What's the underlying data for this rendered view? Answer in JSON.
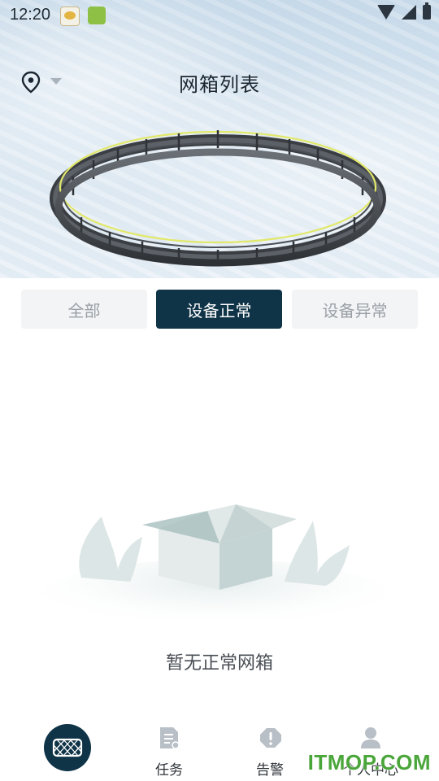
{
  "status_bar": {
    "time": "12:20"
  },
  "header": {
    "title": "网箱列表"
  },
  "tabs": [
    {
      "label": "全部",
      "selected": false
    },
    {
      "label": "设备正常",
      "selected": true
    },
    {
      "label": "设备异常",
      "selected": false
    }
  ],
  "empty_state": {
    "message": "暂无正常网箱"
  },
  "bottom_nav": {
    "items": [
      {
        "label": "",
        "icon": "net-cage-icon",
        "active": true
      },
      {
        "label": "任务",
        "icon": "task-icon",
        "active": false
      },
      {
        "label": "告警",
        "icon": "alarm-icon",
        "active": false
      },
      {
        "label": "个人中心",
        "icon": "person-icon",
        "active": false
      }
    ]
  },
  "watermark": {
    "text": "ITMOP.COM"
  },
  "colors": {
    "primary": "#0f3347",
    "tab_inactive_bg": "#f3f4f6",
    "tab_inactive_text": "#9aa0a6",
    "watermark": "#4aa63a"
  }
}
